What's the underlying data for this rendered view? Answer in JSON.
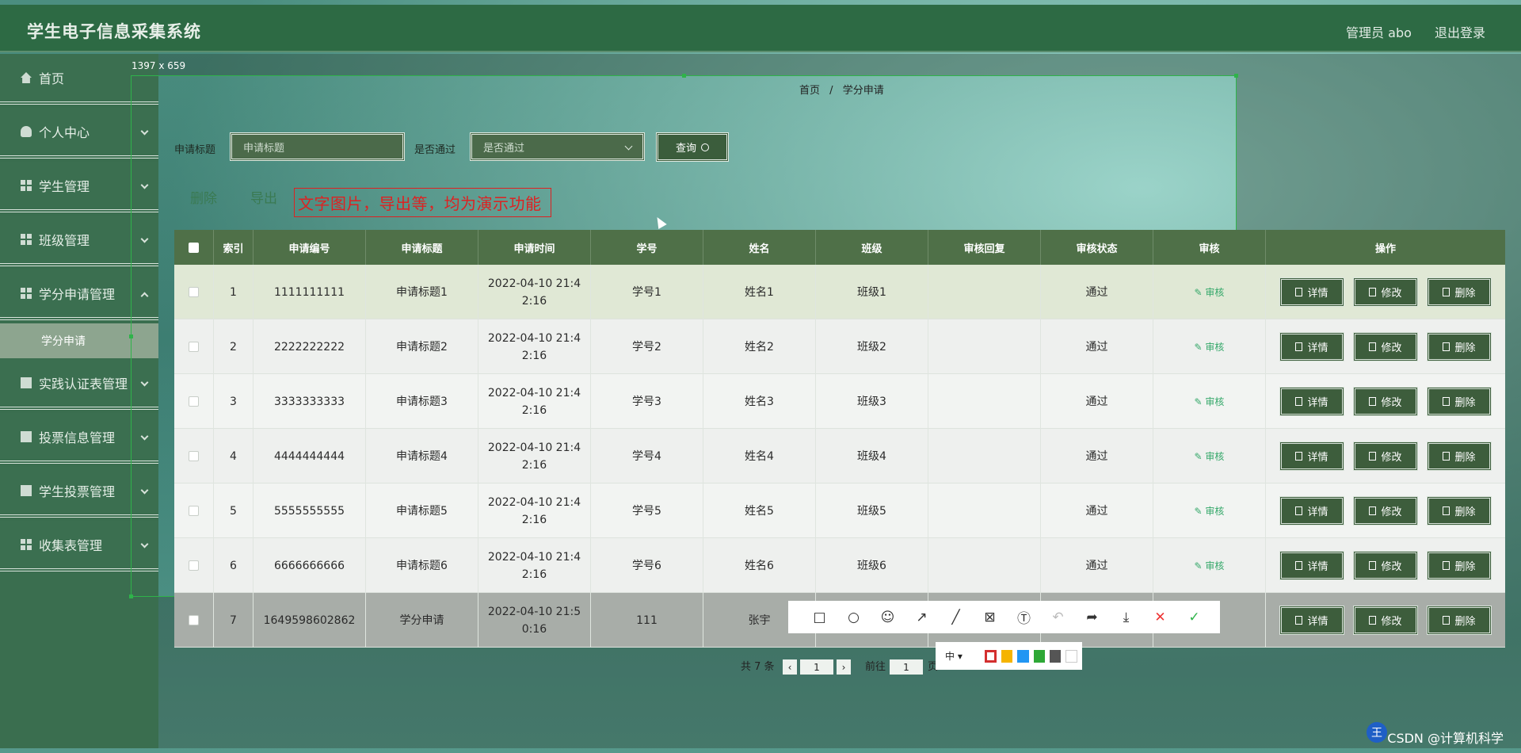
{
  "app_title": "学生电子信息采集系统",
  "header": {
    "admin_label": "管理员 abo",
    "logout": "退出登录"
  },
  "sidebar": {
    "items": [
      {
        "label": "首页"
      },
      {
        "label": "个人中心"
      },
      {
        "label": "学生管理"
      },
      {
        "label": "班级管理"
      },
      {
        "label": "学分申请管理"
      },
      {
        "label": "实践认证表管理"
      },
      {
        "label": "投票信息管理"
      },
      {
        "label": "学生投票管理"
      },
      {
        "label": "收集表管理"
      }
    ],
    "active_sub": "学分申请"
  },
  "selection_size": "1397 x 659",
  "breadcrumb": {
    "home": "首页",
    "sep": "/",
    "current": "学分申请"
  },
  "search": {
    "title_label": "申请标题",
    "title_placeholder": "申请标题",
    "pass_label": "是否通过",
    "pass_value": "是否通过",
    "query_button": "查询"
  },
  "actions": {
    "delete": "删除",
    "export": "导出"
  },
  "notice": "文字图片，导出等，均为演示功能",
  "table": {
    "headers": [
      "索引",
      "申请编号",
      "申请标题",
      "申请时间",
      "学号",
      "姓名",
      "班级",
      "审核回复",
      "审核状态",
      "审核",
      "操作"
    ],
    "rows": [
      {
        "idx": "1",
        "no": "1111111111",
        "title": "申请标题1",
        "time": "2022-04-10 21:4\n2:16",
        "sid": "学号1",
        "name": "姓名1",
        "class": "班级1",
        "reply": "",
        "status": "通过"
      },
      {
        "idx": "2",
        "no": "2222222222",
        "title": "申请标题2",
        "time": "2022-04-10 21:4\n2:16",
        "sid": "学号2",
        "name": "姓名2",
        "class": "班级2",
        "reply": "",
        "status": "通过"
      },
      {
        "idx": "3",
        "no": "3333333333",
        "title": "申请标题3",
        "time": "2022-04-10 21:4\n2:16",
        "sid": "学号3",
        "name": "姓名3",
        "class": "班级3",
        "reply": "",
        "status": "通过"
      },
      {
        "idx": "4",
        "no": "4444444444",
        "title": "申请标题4",
        "time": "2022-04-10 21:4\n2:16",
        "sid": "学号4",
        "name": "姓名4",
        "class": "班级4",
        "reply": "",
        "status": "通过"
      },
      {
        "idx": "5",
        "no": "5555555555",
        "title": "申请标题5",
        "time": "2022-04-10 21:4\n2:16",
        "sid": "学号5",
        "name": "姓名5",
        "class": "班级5",
        "reply": "",
        "status": "通过"
      },
      {
        "idx": "6",
        "no": "6666666666",
        "title": "申请标题6",
        "time": "2022-04-10 21:4\n2:16",
        "sid": "学号6",
        "name": "姓名6",
        "class": "班级6",
        "reply": "",
        "status": "通过"
      },
      {
        "idx": "7",
        "no": "1649598602862",
        "title": "学分申请",
        "time": "2022-04-10 21:5\n0:16",
        "sid": "111",
        "name": "张宇",
        "class": "",
        "reply": "",
        "status": ""
      }
    ],
    "audit_label": "审核",
    "op_detail": "详情",
    "op_edit": "修改",
    "op_delete": "删除"
  },
  "pagination": {
    "total": "共 7 条",
    "page": "1",
    "goto": "前往",
    "goto_page": "1",
    "page_unit": "页"
  },
  "snip_toolbar": {
    "size_label": "中",
    "colors": [
      "#d32f2f",
      "#f5b400",
      "#2196f3",
      "#2ea836",
      "#555555",
      "#ffffff"
    ]
  },
  "watermark": "CSDN @计算机科学"
}
